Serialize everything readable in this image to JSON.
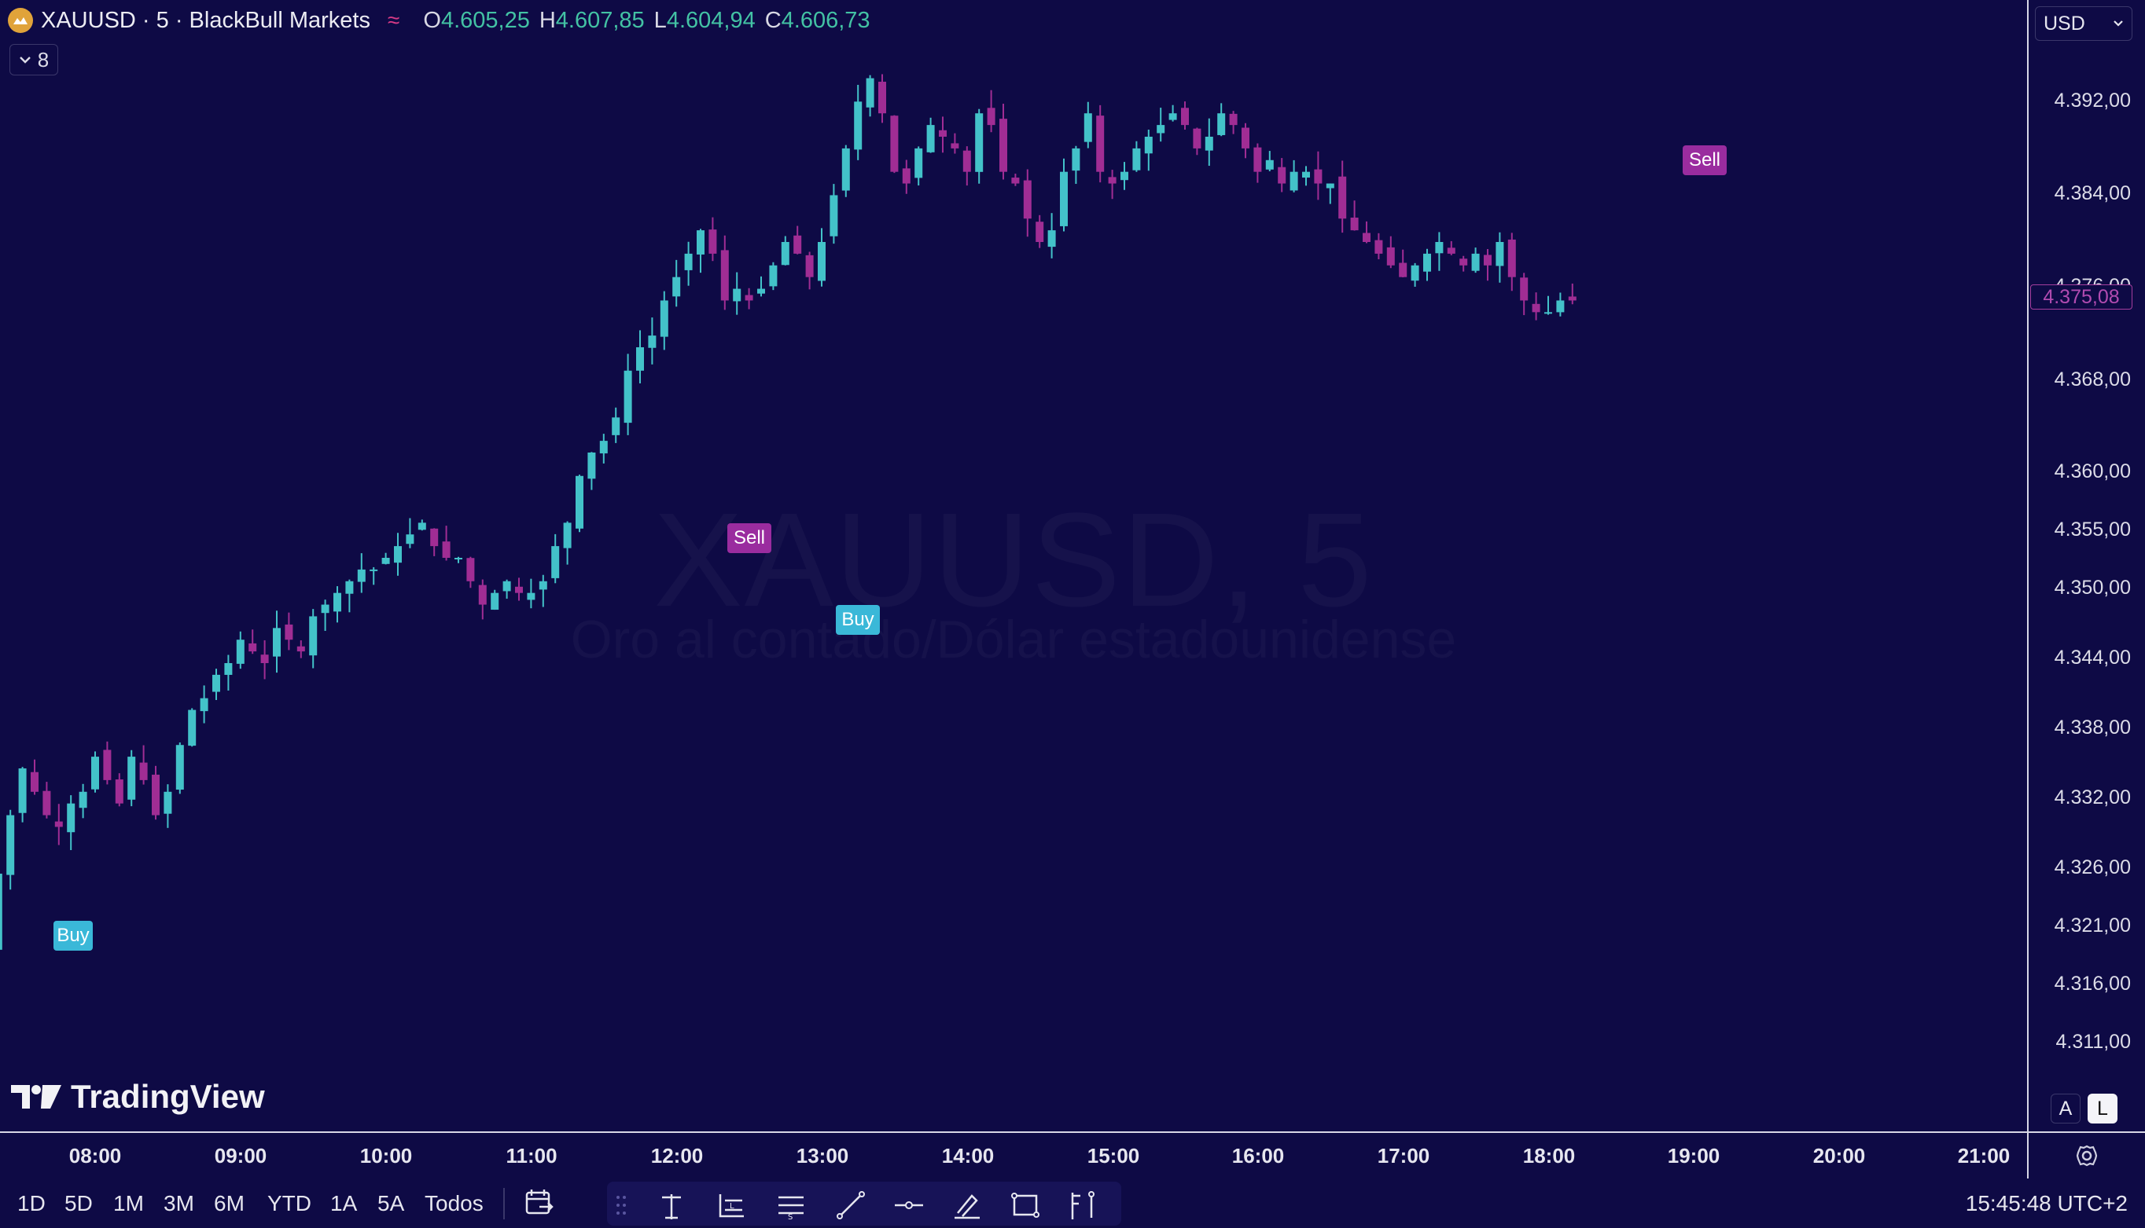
{
  "header": {
    "symbol_title": "XAUUSD · 5 · BlackBull Markets",
    "open_key": "O",
    "open": "4.605,25",
    "high_key": "H",
    "high": "4.607,85",
    "low_key": "L",
    "low": "4.604,94",
    "close_key": "C",
    "close": "4.606,73",
    "indicator_count": "8"
  },
  "watermark": {
    "symbol": "XAUUSD, 5",
    "description": "Oro al contado/Dólar estadounidense"
  },
  "logo_text": "TradingView",
  "price_axis": {
    "currency": "USD",
    "last_price": "4.375,08",
    "ticks": [
      "4.392,00",
      "4.384,00",
      "4.376,00",
      "4.368,00",
      "4.360,00",
      "4.355,00",
      "4.350,00",
      "4.344,00",
      "4.338,00",
      "4.332,00",
      "4.326,00",
      "4.321,00",
      "4.316,00",
      "4.311,00"
    ],
    "scale_auto": "A",
    "scale_log": "L"
  },
  "time_axis": {
    "ticks": [
      "08:00",
      "09:00",
      "10:00",
      "11:00",
      "12:00",
      "13:00",
      "14:00",
      "15:00",
      "16:00",
      "17:00",
      "18:00",
      "19:00",
      "20:00",
      "21:00"
    ]
  },
  "signals": [
    {
      "type": "buy",
      "label": "Buy"
    },
    {
      "type": "sell",
      "label": "Sell"
    },
    {
      "type": "buy",
      "label": "Buy"
    },
    {
      "type": "sell",
      "label": "Sell"
    }
  ],
  "bottom_bar": {
    "ranges": [
      "1D",
      "5D",
      "1M",
      "3M",
      "6M",
      "YTD",
      "1A",
      "5A",
      "Todos"
    ],
    "clock": "15:45:48 UTC+2"
  },
  "colors": {
    "background": "#0e0a45",
    "up": "#43c2c9",
    "down": "#a02d94",
    "buy": "#3ab8d8",
    "sell": "#9a2c9f"
  },
  "chart_data": {
    "type": "candlestick",
    "title": "XAUUSD, 5",
    "ylim": [
      4308,
      4398
    ],
    "x_ticks": [
      "08:00",
      "09:00",
      "10:00",
      "11:00",
      "12:00",
      "13:00",
      "14:00",
      "15:00",
      "16:00",
      "17:00",
      "18:00",
      "19:00",
      "20:00",
      "21:00"
    ],
    "close_path": [
      4318,
      4320,
      4326,
      4331,
      4335,
      4333,
      4331,
      4330,
      4332,
      4333,
      4336,
      4334,
      4332,
      4336,
      4334,
      4331,
      4333,
      4337,
      4340,
      4341,
      4343,
      4344,
      4346,
      4345,
      4344,
      4347,
      4346,
      4345,
      4348,
      4349,
      4350,
      4351,
      4352,
      4352,
      4353,
      4354,
      4355,
      4356,
      4354,
      4353,
      4353,
      4351,
      4349,
      4350,
      4351,
      4350,
      4350,
      4351,
      4354,
      4356,
      4360,
      4362,
      4363,
      4365,
      4369,
      4371,
      4372,
      4375,
      4377,
      4379,
      4381,
      4379,
      4375,
      4376,
      4375,
      4376,
      4378,
      4380,
      4379,
      4377,
      4380,
      4384,
      4388,
      4392,
      4394,
      4391,
      4386,
      4385,
      4388,
      4390,
      4389,
      4388,
      4386,
      4391,
      4390,
      4386,
      4385,
      4382,
      4380,
      4381,
      4386,
      4388,
      4391,
      4386,
      4385,
      4386,
      4388,
      4389,
      4390,
      4391,
      4390,
      4388,
      4389,
      4391,
      4390,
      4388,
      4386,
      4387,
      4385,
      4386,
      4386,
      4385,
      4385,
      4382,
      4381,
      4380,
      4379,
      4378,
      4377,
      4378,
      4379,
      4380,
      4379,
      4378,
      4379,
      4378,
      4380,
      4377,
      4375,
      4374,
      4374,
      4375,
      4375
    ]
  }
}
